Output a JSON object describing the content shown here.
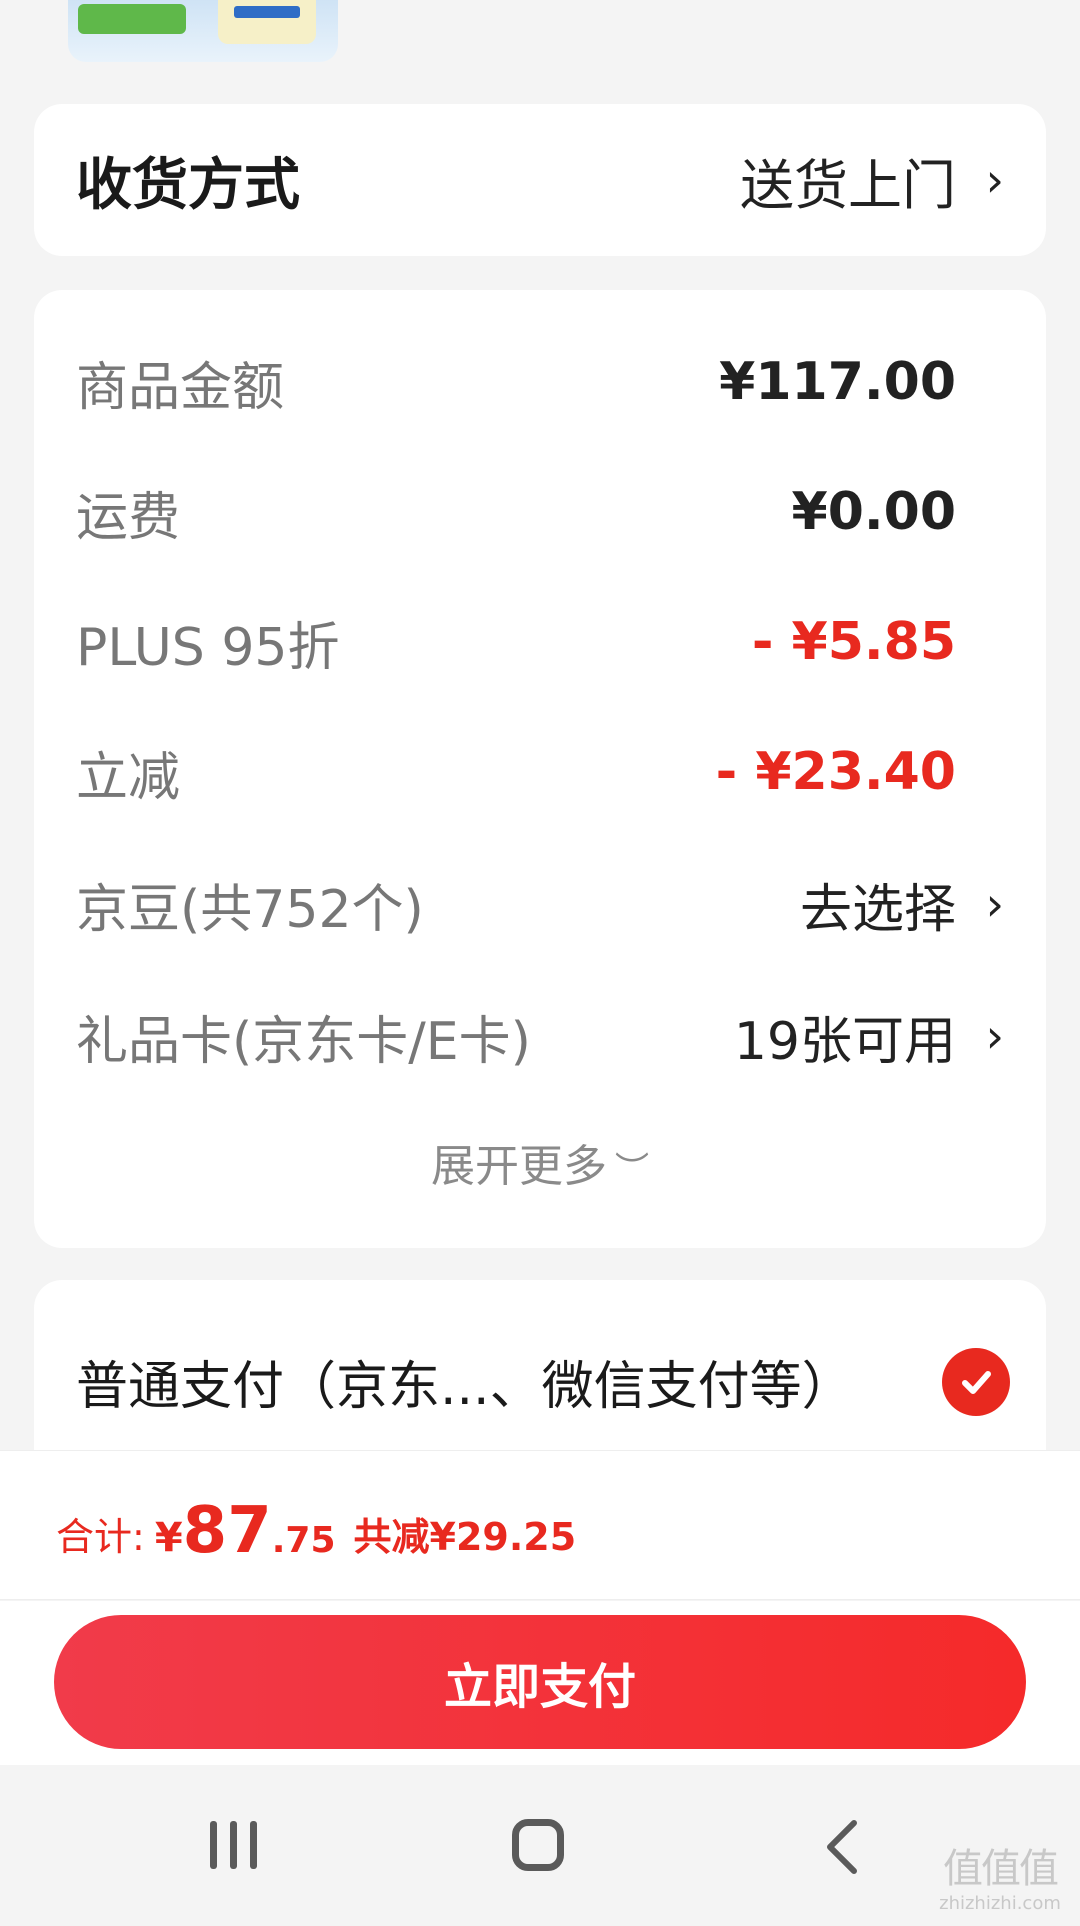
{
  "delivery": {
    "label": "收货方式",
    "value": "送货上门"
  },
  "amounts": {
    "rows": [
      {
        "label": "商品金额",
        "value": "¥117.00"
      },
      {
        "label": "运费",
        "value": "¥0.00"
      },
      {
        "label": "PLUS 95折",
        "value": "- ¥5.85"
      },
      {
        "label": "立减",
        "value": "- ¥23.40"
      },
      {
        "label": "京豆(共752个)",
        "value": "去选择"
      },
      {
        "label": "礼品卡(京东卡/E卡)",
        "value": "19张可用"
      }
    ],
    "expand_label": "展开更多"
  },
  "payment": {
    "method_label": "普通支付（京东...、微信支付等）",
    "selected": true
  },
  "total": {
    "label": "合计:",
    "currency": "¥",
    "amount_int": "87",
    "amount_dec": ".75",
    "saved": "共减¥29.25"
  },
  "pay_button": {
    "label": "立即支付"
  },
  "watermark": {
    "glyphs": "值值值",
    "text": "zhizhizhi.com"
  },
  "colors": {
    "accent_red": "#e8291f",
    "button_gradient_start": "#f13b4a",
    "button_gradient_end": "#f52a2a"
  }
}
